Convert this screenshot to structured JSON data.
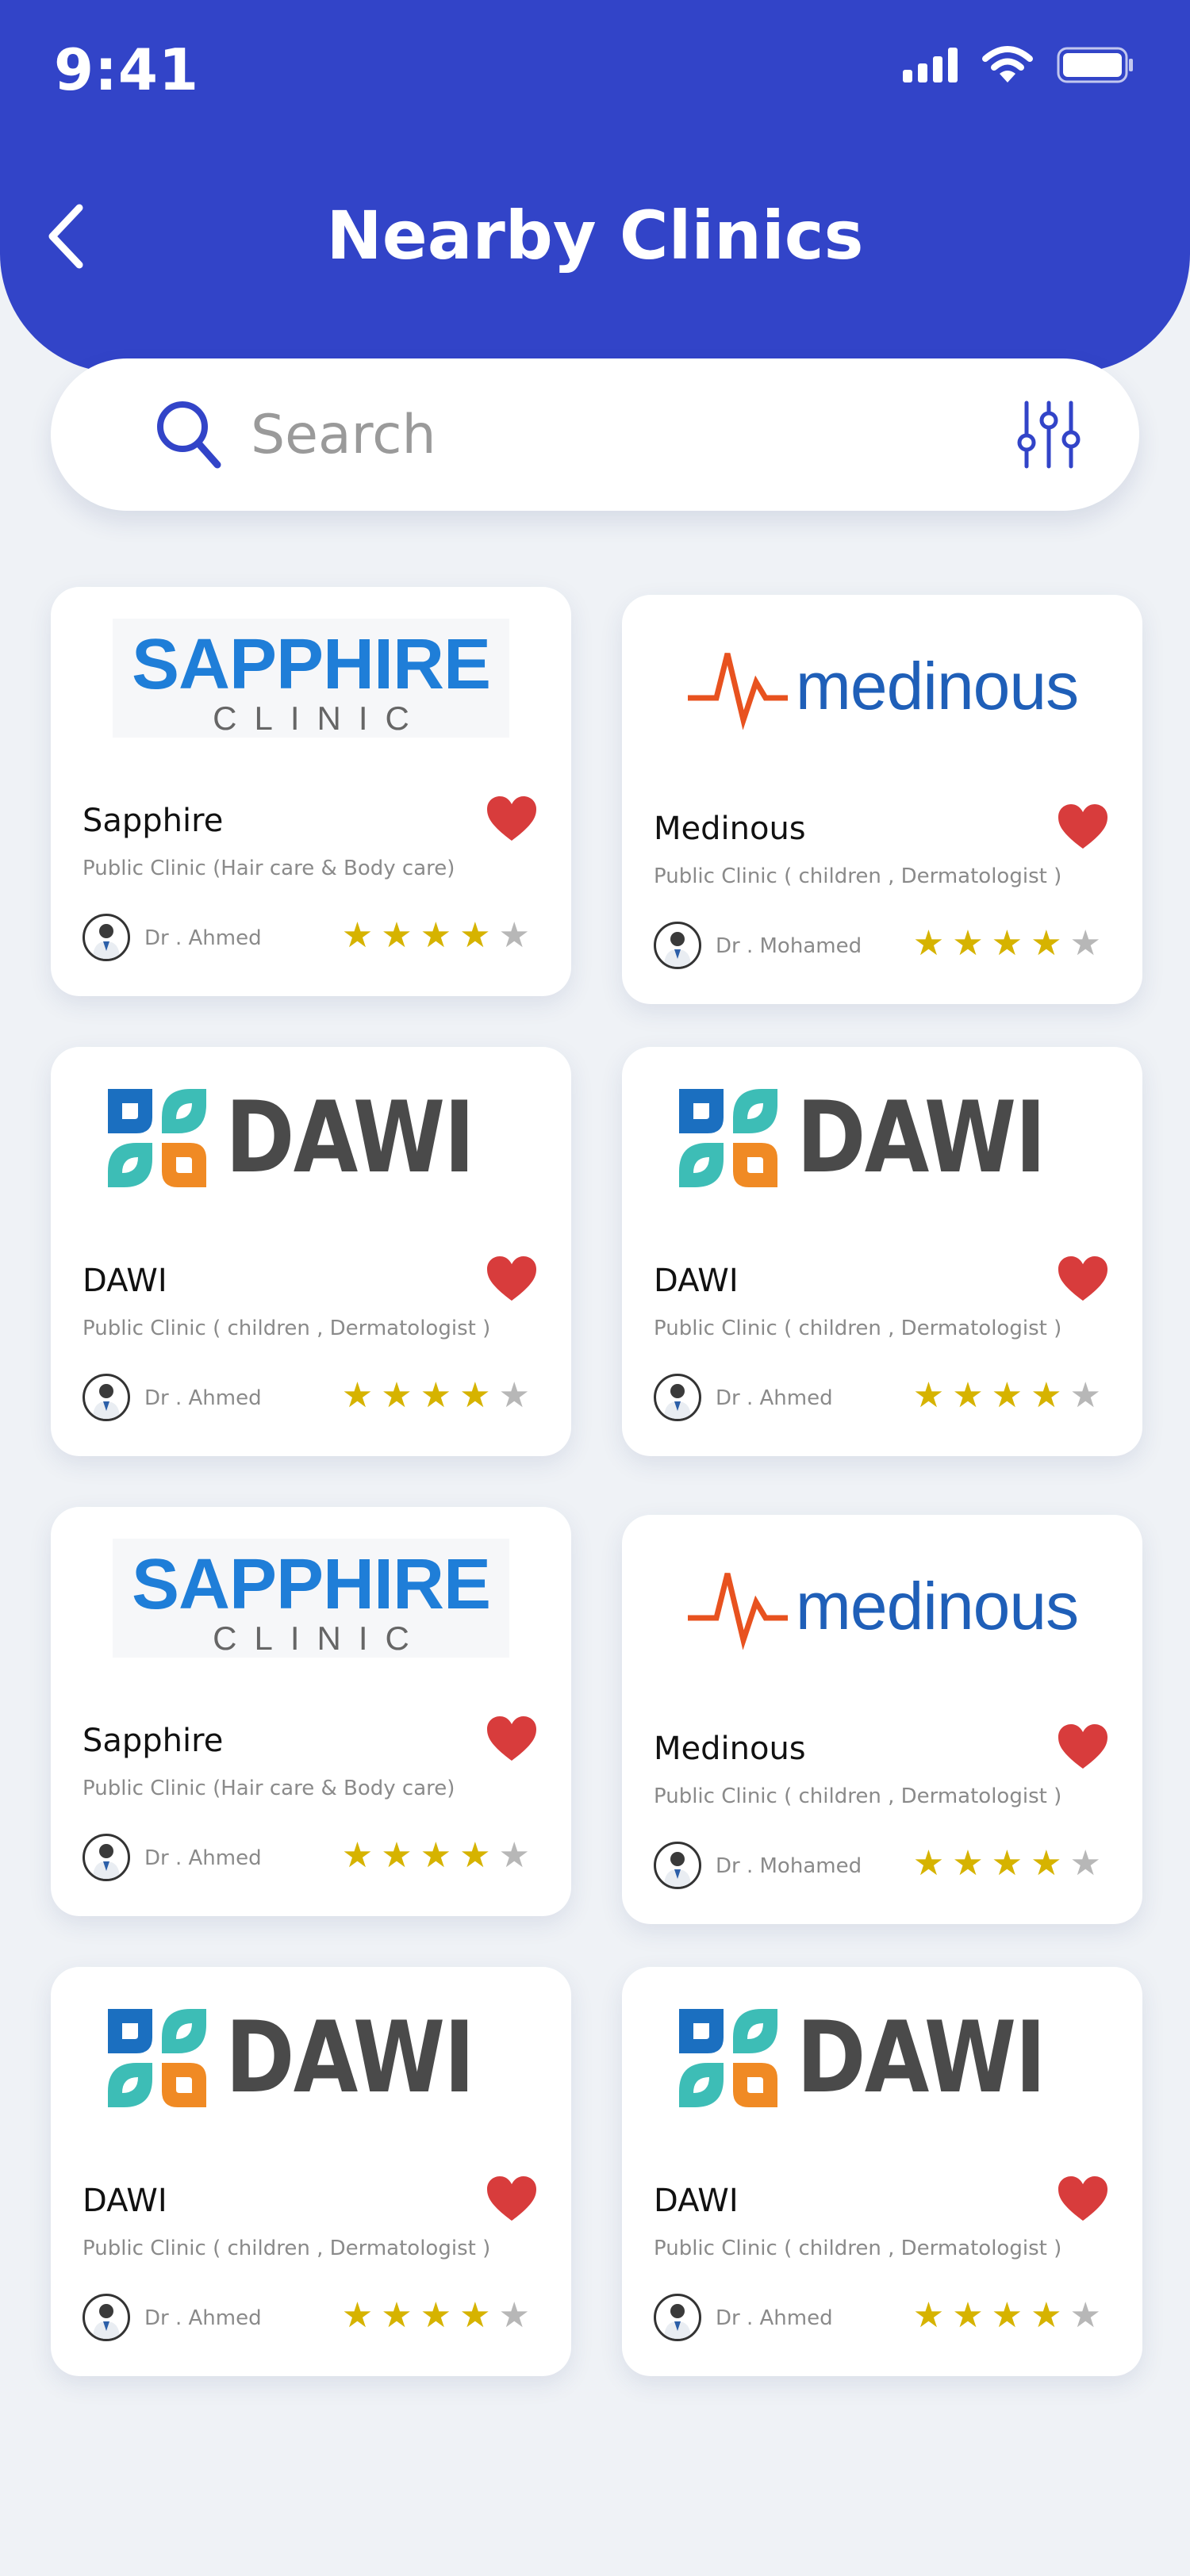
{
  "status": {
    "time": "9:41"
  },
  "header": {
    "title": "Nearby Clinics"
  },
  "search": {
    "placeholder": "Search",
    "value": ""
  },
  "colors": {
    "primary": "#3244c8",
    "heart": "#d83c3c",
    "star_on": "#d6b300",
    "star_off": "#b7b7b7"
  },
  "clinics": [
    {
      "name": "Sapphire",
      "logo": "sapphire",
      "logo_main": "SAPPHIRE",
      "logo_sub": "CLINIC",
      "subtitle": "Public Clinic (Hair care & Body care)",
      "doctor": "Dr . Ahmed",
      "rating": 4,
      "favorite": true
    },
    {
      "name": "Medinous",
      "logo": "medinous",
      "logo_main": "medinous",
      "subtitle": "Public Clinic ( children , Dermatologist )",
      "doctor": "Dr . Mohamed",
      "rating": 4,
      "favorite": true
    },
    {
      "name": "DAWI",
      "logo": "dawi",
      "logo_main": "DAWI",
      "subtitle": "Public Clinic ( children , Dermatologist )",
      "doctor": "Dr . Ahmed",
      "rating": 4,
      "favorite": true
    },
    {
      "name": "DAWI",
      "logo": "dawi",
      "logo_main": "DAWI",
      "subtitle": "Public Clinic ( children , Dermatologist )",
      "doctor": "Dr . Ahmed",
      "rating": 4,
      "favorite": true
    },
    {
      "name": "Sapphire",
      "logo": "sapphire",
      "logo_main": "SAPPHIRE",
      "logo_sub": "CLINIC",
      "subtitle": "Public Clinic (Hair care & Body care)",
      "doctor": "Dr . Ahmed",
      "rating": 4,
      "favorite": true
    },
    {
      "name": "Medinous",
      "logo": "medinous",
      "logo_main": "medinous",
      "subtitle": "Public Clinic ( children , Dermatologist )",
      "doctor": "Dr . Mohamed",
      "rating": 4,
      "favorite": true
    },
    {
      "name": "DAWI",
      "logo": "dawi",
      "logo_main": "DAWI",
      "subtitle": "Public Clinic ( children , Dermatologist )",
      "doctor": "Dr . Ahmed",
      "rating": 4,
      "favorite": true
    },
    {
      "name": "DAWI",
      "logo": "dawi",
      "logo_main": "DAWI",
      "subtitle": "Public Clinic ( children , Dermatologist )",
      "doctor": "Dr . Ahmed",
      "rating": 4,
      "favorite": true
    }
  ]
}
